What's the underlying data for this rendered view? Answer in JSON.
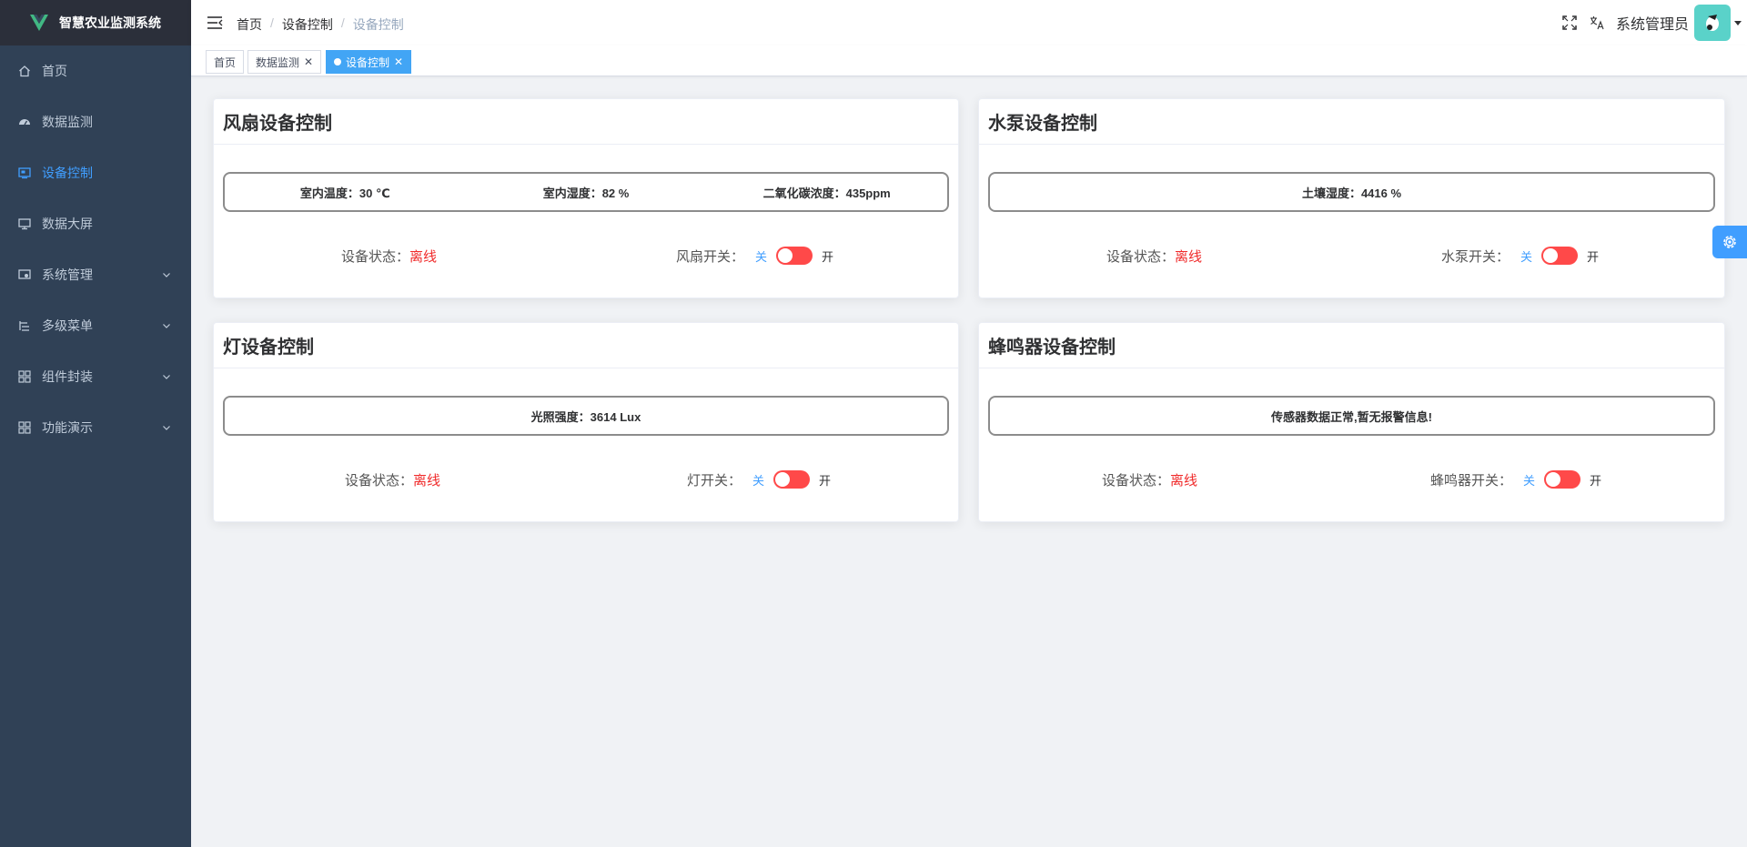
{
  "app": {
    "title": "智慧农业监测系统",
    "brand_color": "#41b883",
    "accent_color": "#409eff",
    "sidebar_bg": "#304156"
  },
  "sidebar": {
    "items": [
      {
        "label": "首页",
        "icon": "home-icon"
      },
      {
        "label": "数据监测",
        "icon": "dashboard-icon"
      },
      {
        "label": "设备控制",
        "icon": "monitor-icon",
        "active": true
      },
      {
        "label": "数据大屏",
        "icon": "screen-icon"
      },
      {
        "label": "系统管理",
        "icon": "system-icon",
        "has_children": true
      },
      {
        "label": "多级菜单",
        "icon": "tree-icon",
        "has_children": true
      },
      {
        "label": "组件封装",
        "icon": "component-icon",
        "has_children": true
      },
      {
        "label": "功能演示",
        "icon": "component-icon",
        "has_children": true
      }
    ]
  },
  "navbar": {
    "breadcrumb": [
      "首页",
      "设备控制",
      "设备控制"
    ],
    "user_name": "系统管理员",
    "icons": [
      "hamburger-icon",
      "fullscreen-icon",
      "translate-icon",
      "caret-down-icon"
    ]
  },
  "tags": [
    {
      "label": "首页",
      "closable": false,
      "active": false
    },
    {
      "label": "数据监测",
      "closable": true,
      "active": false
    },
    {
      "label": "设备控制",
      "closable": true,
      "active": true
    }
  ],
  "cards": {
    "fan": {
      "title": "风扇设备控制",
      "readings": [
        "室内温度：30 ℃",
        "室内湿度：82 %",
        "二氧化碳浓度：435ppm"
      ],
      "status_label": "设备状态：",
      "status_value": "离线",
      "switch_label": "风扇开关：",
      "off_label": "关",
      "on_label": "开",
      "switch_on": false
    },
    "pump": {
      "title": "水泵设备控制",
      "readings": [
        "土壤湿度：4416 %"
      ],
      "status_label": "设备状态：",
      "status_value": "离线",
      "switch_label": "水泵开关：",
      "off_label": "关",
      "on_label": "开",
      "switch_on": false
    },
    "light": {
      "title": "灯设备控制",
      "readings": [
        "光照强度：3614 Lux"
      ],
      "status_label": "设备状态：",
      "status_value": "离线",
      "switch_label": "灯开关：",
      "off_label": "关",
      "on_label": "开",
      "switch_on": false
    },
    "buzzer": {
      "title": "蜂鸣器设备控制",
      "readings": [
        "传感器数据正常,暂无报警信息!"
      ],
      "status_label": "设备状态：",
      "status_value": "离线",
      "switch_label": "蜂鸣器开关：",
      "off_label": "关",
      "on_label": "开",
      "switch_on": false
    }
  },
  "colors": {
    "offline": "#f02b2b",
    "toggle_off": "#ff4949",
    "tag_active": "#42a5f5"
  }
}
